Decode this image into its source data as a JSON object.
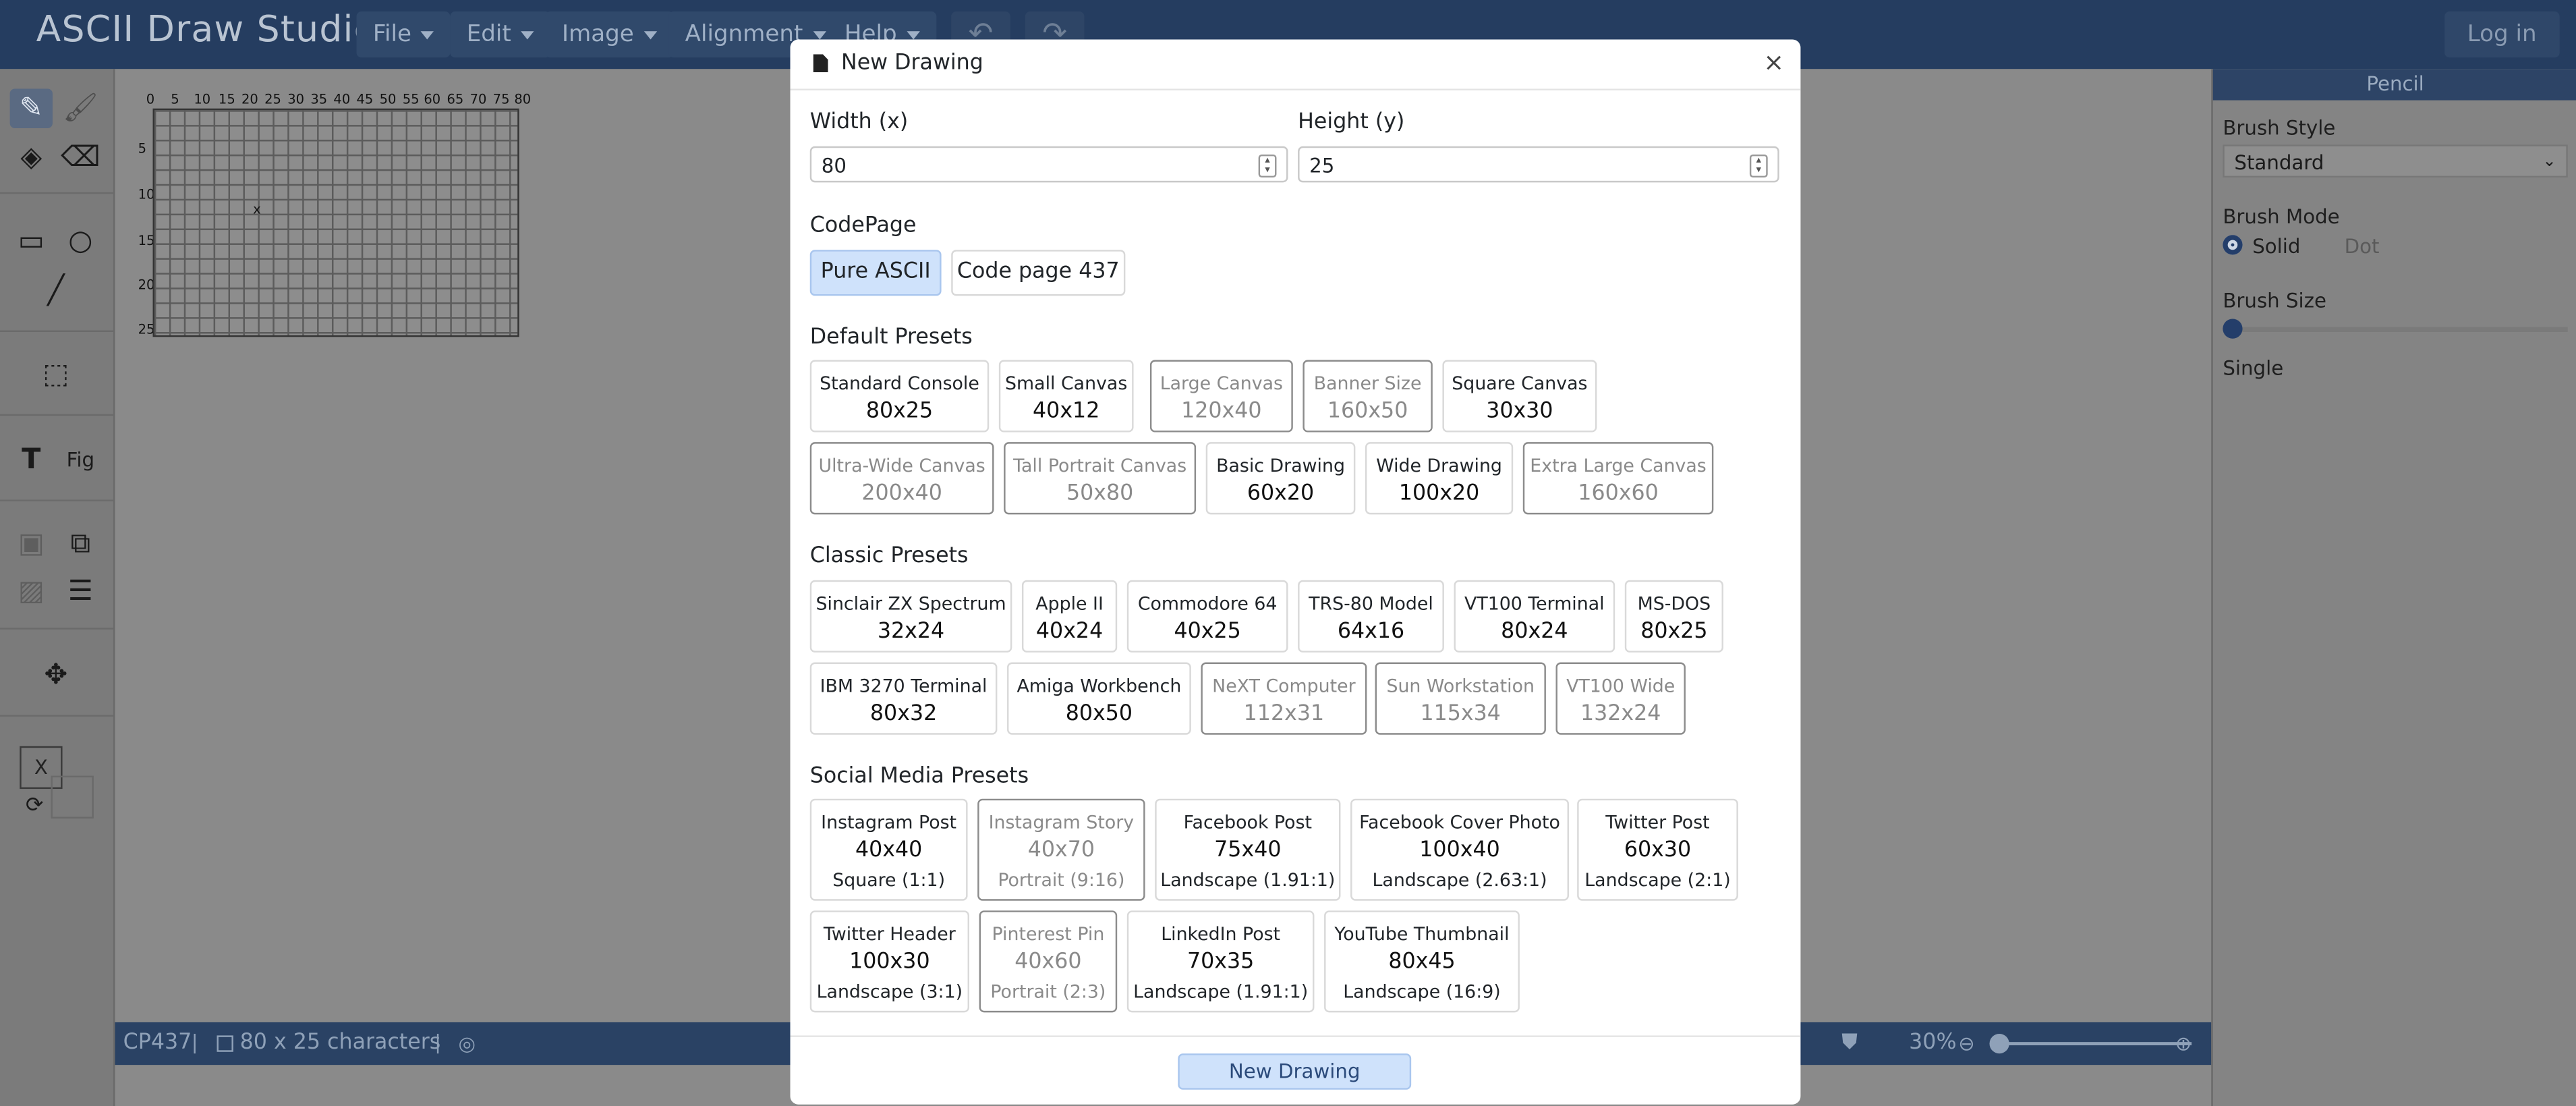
{
  "app": {
    "title": "ASCII Draw Studio",
    "menus": [
      "File",
      "Edit",
      "Image",
      "Alignment",
      "Help"
    ],
    "login_label": "Log in"
  },
  "toolbar": {
    "color_label": "X"
  },
  "canvas": {
    "ruler_x": [
      "0",
      "5",
      "10",
      "15",
      "20",
      "25",
      "30",
      "35",
      "40",
      "45",
      "50",
      "55",
      "60",
      "65",
      "70",
      "75",
      "80"
    ],
    "ruler_y": [
      "5",
      "10",
      "15",
      "20",
      "25"
    ],
    "cursor_char": "x"
  },
  "statusbar": {
    "codepage": "CP437",
    "size_text": "80 x 25 characters",
    "zoom": "30%"
  },
  "right_panel": {
    "title": "Pencil",
    "brush_style_label": "Brush Style",
    "brush_style_value": "Standard",
    "brush_mode_label": "Brush Mode",
    "mode_solid": "Solid",
    "mode_dot": "Dot",
    "brush_size_label": "Brush Size",
    "brush_size_value": "Single"
  },
  "modal": {
    "title": "New Drawing",
    "width_label": "Width (x)",
    "width_value": "80",
    "height_label": "Height (y)",
    "height_value": "25",
    "codepage_label": "CodePage",
    "codepages": [
      "Pure ASCII",
      "Code page 437"
    ],
    "default_presets_title": "Default Presets",
    "default_presets": [
      {
        "name": "Standard Console",
        "size": "80x25"
      },
      {
        "name": "Small Canvas",
        "size": "40x12"
      },
      {
        "name": "Large Canvas",
        "size": "120x40"
      },
      {
        "name": "Banner Size",
        "size": "160x50"
      },
      {
        "name": "Square Canvas",
        "size": "30x30"
      },
      {
        "name": "Ultra-Wide Canvas",
        "size": "200x40"
      },
      {
        "name": "Tall Portrait Canvas",
        "size": "50x80"
      },
      {
        "name": "Basic Drawing",
        "size": "60x20"
      },
      {
        "name": "Wide Drawing",
        "size": "100x20"
      },
      {
        "name": "Extra Large Canvas",
        "size": "160x60"
      }
    ],
    "classic_presets_title": "Classic Presets",
    "classic_presets": [
      {
        "name": "Sinclair ZX Spectrum",
        "size": "32x24"
      },
      {
        "name": "Apple II",
        "size": "40x24"
      },
      {
        "name": "Commodore 64",
        "size": "40x25"
      },
      {
        "name": "TRS-80 Model",
        "size": "64x16"
      },
      {
        "name": "VT100 Terminal",
        "size": "80x24"
      },
      {
        "name": "MS-DOS",
        "size": "80x25"
      },
      {
        "name": "IBM 3270 Terminal",
        "size": "80x32"
      },
      {
        "name": "Amiga Workbench",
        "size": "80x50"
      },
      {
        "name": "NeXT Computer",
        "size": "112x31"
      },
      {
        "name": "Sun Workstation",
        "size": "115x34"
      },
      {
        "name": "VT100 Wide",
        "size": "132x24"
      }
    ],
    "social_presets_title": "Social Media Presets",
    "social_presets": [
      {
        "name": "Instagram Post",
        "size": "40x40",
        "ratio": "Square (1:1)"
      },
      {
        "name": "Instagram Story",
        "size": "40x70",
        "ratio": "Portrait (9:16)"
      },
      {
        "name": "Facebook Post",
        "size": "75x40",
        "ratio": "Landscape (1.91:1)"
      },
      {
        "name": "Facebook Cover Photo",
        "size": "100x40",
        "ratio": "Landscape (2.63:1)"
      },
      {
        "name": "Twitter Post",
        "size": "60x30",
        "ratio": "Landscape (2:1)"
      },
      {
        "name": "Twitter Header",
        "size": "100x30",
        "ratio": "Landscape (3:1)"
      },
      {
        "name": "Pinterest Pin",
        "size": "40x60",
        "ratio": "Portrait (2:3)"
      },
      {
        "name": "LinkedIn Post",
        "size": "70x35",
        "ratio": "Landscape (1.91:1)"
      },
      {
        "name": "YouTube Thumbnail",
        "size": "80x45",
        "ratio": "Landscape (16:9)"
      }
    ],
    "submit_label": "New Drawing"
  },
  "colors": {
    "menubar": "#253d60",
    "accent_selected": "#cfe2fb",
    "overlay": "#8a8a8a"
  }
}
